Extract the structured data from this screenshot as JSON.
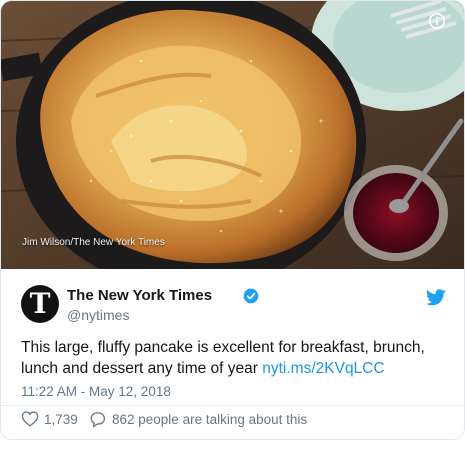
{
  "photo": {
    "credit": "Jim Wilson/The New York Times",
    "info_icon": "info-icon"
  },
  "account": {
    "name": "The New York Times",
    "handle": "@nytimes",
    "avatar_glyph": "T",
    "verified_icon": "verified-badge-icon",
    "brand_icon": "twitter-bird-icon"
  },
  "tweet": {
    "text": "This large, fluffy pancake is excellent for breakfast, brunch, lunch and dessert any time of year",
    "link": "nyti.ms/2KVqLCC",
    "timestamp": "11:22 AM - May 12, 2018"
  },
  "actions": {
    "like_count": "1,739",
    "talking_label": "862 people are talking about this"
  },
  "colors": {
    "link": "#1b95e0",
    "text": "#14171a",
    "muted": "#657786",
    "twitter_blue": "#1da1f2"
  }
}
